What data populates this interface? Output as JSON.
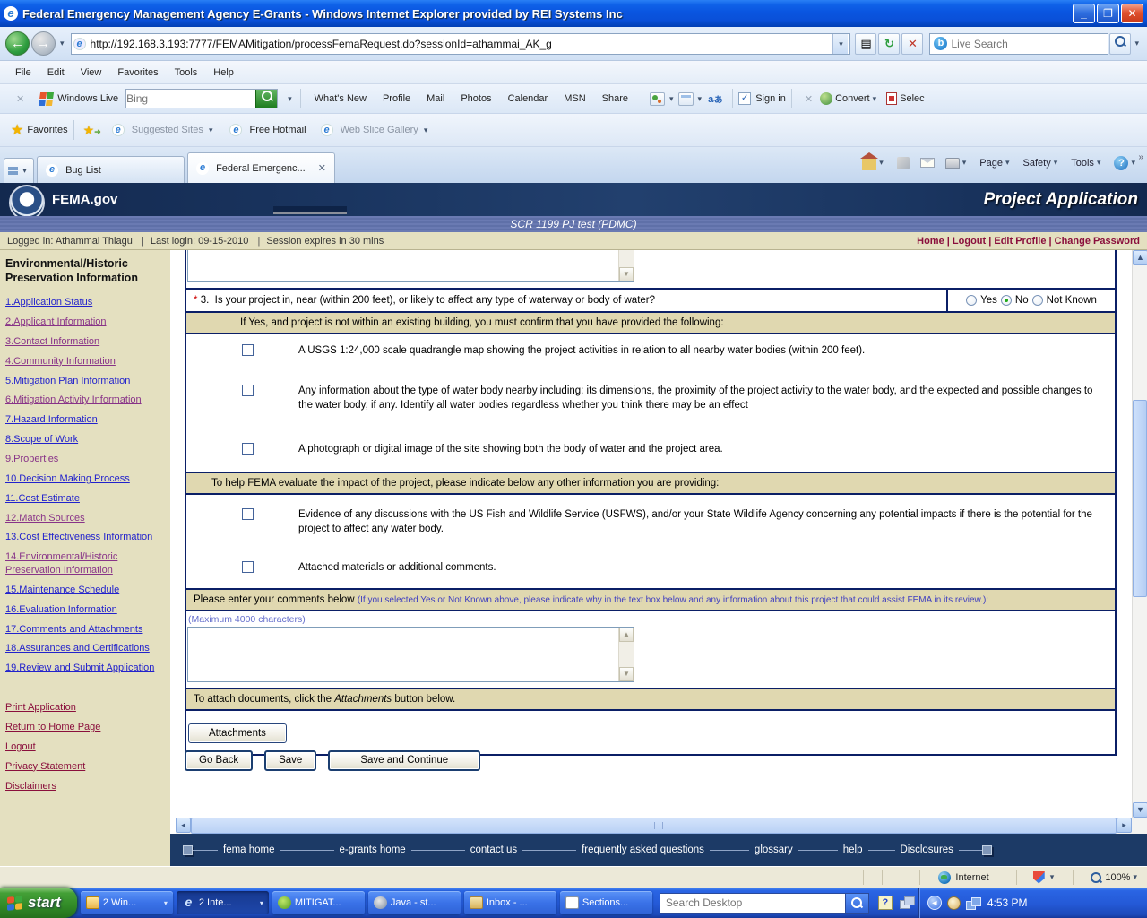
{
  "window": {
    "title": "Federal Emergency Management Agency E-Grants - Windows Internet Explorer provided by REI Systems Inc",
    "url": "http://192.168.3.193:7777/FEMAMitigation/processFemaRequest.do?sessionId=athammai_AK_g",
    "live_search_placeholder": "Live Search",
    "menu": [
      "File",
      "Edit",
      "View",
      "Favorites",
      "Tools",
      "Help"
    ],
    "live_toolbar": {
      "brand": "Windows Live",
      "bing_placeholder": "Bing",
      "links": [
        "What's New",
        "Profile",
        "Mail",
        "Photos",
        "Calendar",
        "MSN",
        "Share"
      ],
      "sign_in": "Sign in",
      "convert": "Convert",
      "select": "Selec"
    },
    "favorites_bar": {
      "favorites": "Favorites",
      "items": [
        "Suggested Sites",
        "Free Hotmail",
        "Web Slice Gallery"
      ]
    },
    "tabs": [
      {
        "label": "Bug List"
      },
      {
        "label": "Federal Emergenc..."
      }
    ],
    "command_bar": [
      "Page",
      "Safety",
      "Tools"
    ]
  },
  "fema": {
    "brand": "FEMA.gov",
    "page_title": "Project Application",
    "subtitle": "SCR 1199 PJ test (PDMC)",
    "session": {
      "logged_in": "Logged in: Athammai Thiagu",
      "last_login": "Last login: 09-15-2010",
      "expires": "Session expires in 30 mins",
      "links": [
        "Home",
        "Logout",
        "Edit Profile",
        "Change Password"
      ]
    },
    "sidebar": {
      "heading": "Environmental/Historic Preservation Information",
      "items": [
        "1.Application Status",
        "2.Applicant Information",
        "3.Contact Information",
        "4.Community Information",
        "5.Mitigation Plan Information",
        "6.Mitigation Activity Information",
        "7.Hazard Information",
        "8.Scope of Work",
        "9.Properties",
        "10.Decision Making Process",
        "11.Cost Estimate",
        "12.Match Sources",
        "13.Cost Effectiveness Information",
        "14.Environmental/Historic Preservation Information",
        "15.Maintenance Schedule",
        "16.Evaluation Information",
        "17.Comments and Attachments",
        "18.Assurances and Certifications",
        "19.Review and Submit Application"
      ],
      "footer_links": [
        "Print Application",
        "Return to Home Page",
        "Logout",
        "Privacy Statement",
        "Disclaimers"
      ]
    },
    "form": {
      "q_mark": "*",
      "q_num": "3.",
      "q_text": "Is your project in, near (within 200 feet), or likely to affect any type of waterway or body of water?",
      "options": [
        "Yes",
        "No",
        "Not Known"
      ],
      "selected": "No",
      "s1_header": "If Yes, and project is not within an existing building, you must confirm that you have provided the following:",
      "s1_items": [
        "A USGS 1:24,000 scale quadrangle map showing the project activities in relation to all nearby water bodies (within 200 feet).",
        "Any information about the type of water body nearby including: its dimensions, the proximity of the project activity to the water body, and the expected and possible changes to the water body, if any. Identify all water bodies regardless whether you think there may be an effect",
        "A photograph or digital image of the site showing both the body of water and the project area."
      ],
      "s2_header": "To help FEMA evaluate the impact of the project, please indicate below any other information you are providing:",
      "s2_items": [
        "Evidence of any discussions with the US Fish and Wildlife Service (USFWS), and/or your State Wildlife Agency concerning any potential impacts if there is the potential for the project to affect any water body.",
        "Attached materials or additional comments."
      ],
      "comments_label": "Please enter your comments below ",
      "comments_note": "(If you selected Yes or Not Known above, please indicate why in the text box below and any information about this project that could assist FEMA in its review.):",
      "max_note": "(Maximum 4000 characters)",
      "attach_pre": "To attach documents, click the ",
      "attach_word": "Attachments",
      "attach_post": " button below.",
      "attachments_button": "Attachments",
      "buttons": {
        "go_back": "Go Back",
        "save": "Save",
        "save_continue": "Save and Continue"
      }
    },
    "footer_links": [
      "fema home",
      "e-grants home",
      "contact us",
      "frequently asked questions",
      "glossary",
      "help",
      "Disclosures"
    ]
  },
  "statusbar": {
    "zone": "Internet",
    "zoom": "100%"
  },
  "taskbar": {
    "start": "start",
    "items": [
      "2 Win...",
      "2 Inte...",
      "MITIGAT...",
      "Java - st...",
      "Inbox - ...",
      "Sections..."
    ],
    "search_placeholder": "Search Desktop",
    "time": "4:53 PM"
  },
  "colors": {
    "fema_navy": "#1c3a66",
    "band_tan": "#e0d8b0",
    "sidebar_tan": "#e4e0c0",
    "link_blue": "#2222cc",
    "link_visited": "#883388",
    "link_maroon": "#8a0f3c"
  }
}
